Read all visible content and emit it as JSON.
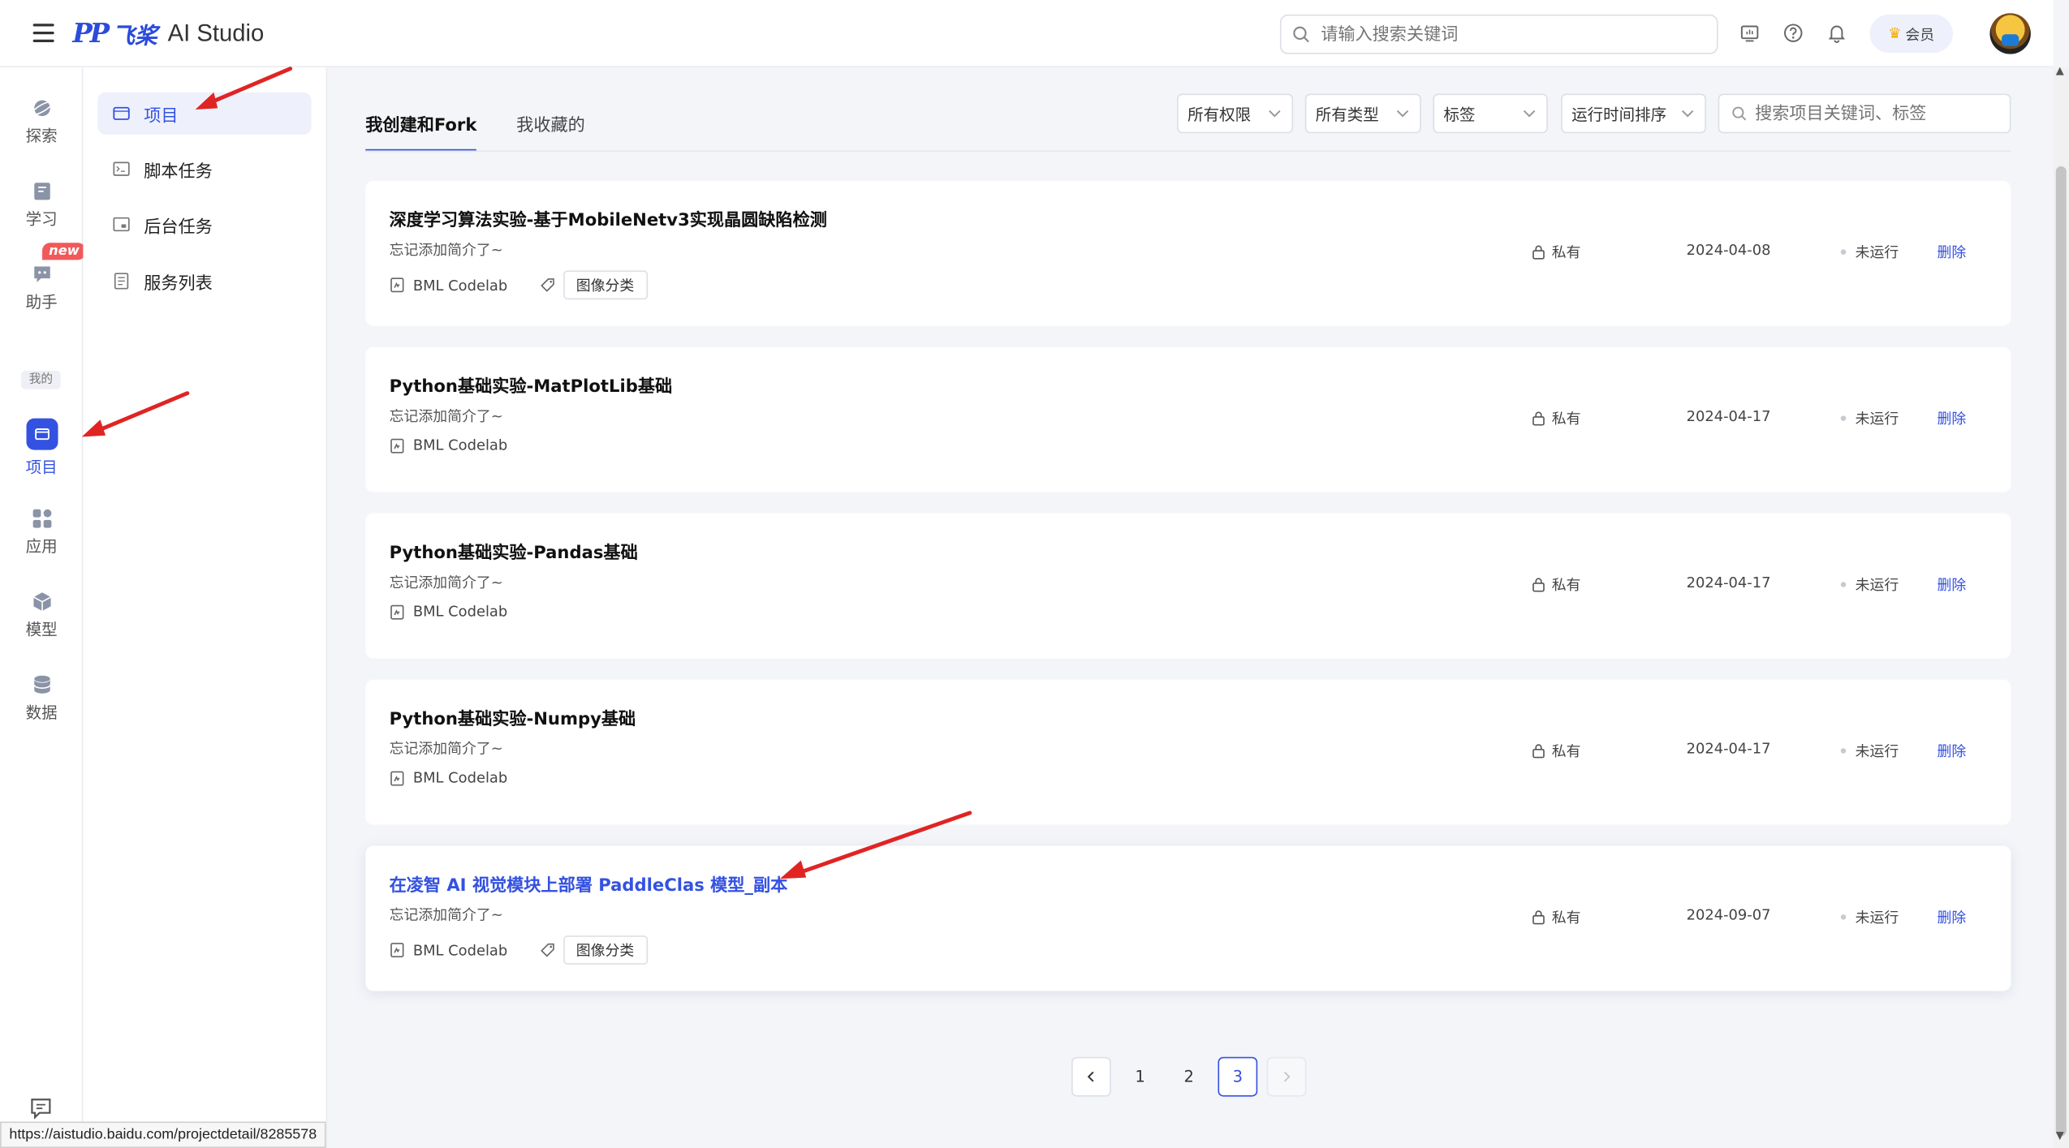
{
  "brand": {
    "mark": "PP",
    "cn": "飞桨",
    "en": "AI Studio"
  },
  "search": {
    "placeholder": "请输入搜索关键词"
  },
  "vip": {
    "label": "会员"
  },
  "rail": {
    "items": [
      {
        "label": "探索"
      },
      {
        "label": "学习"
      },
      {
        "label": "助手"
      },
      {
        "label": "项目"
      },
      {
        "label": "应用"
      },
      {
        "label": "模型"
      },
      {
        "label": "数据"
      }
    ],
    "new_badge": "new",
    "mine": "我的"
  },
  "subnav": {
    "items": [
      {
        "label": "项目"
      },
      {
        "label": "脚本任务"
      },
      {
        "label": "后台任务"
      },
      {
        "label": "服务列表"
      }
    ]
  },
  "tabs": [
    {
      "label": "我创建和Fork"
    },
    {
      "label": "我收藏的"
    }
  ],
  "filters": {
    "permission": "所有权限",
    "type": "所有类型",
    "tag": "标签",
    "sort": "运行时间排序",
    "search_placeholder": "搜索项目关键词、标签"
  },
  "projects": [
    {
      "title": "深度学习算法实验-基于MobileNetv3实现晶圆缺陷检测",
      "desc": "忘记添加简介了~",
      "env": "BML Codelab",
      "tag": "图像分类",
      "privacy": "私有",
      "date": "2024-04-08",
      "status": "未运行",
      "action": "删除"
    },
    {
      "title": "Python基础实验-MatPlotLib基础",
      "desc": "忘记添加简介了~",
      "env": "BML Codelab",
      "tag": "",
      "privacy": "私有",
      "date": "2024-04-17",
      "status": "未运行",
      "action": "删除"
    },
    {
      "title": "Python基础实验-Pandas基础",
      "desc": "忘记添加简介了~",
      "env": "BML Codelab",
      "tag": "",
      "privacy": "私有",
      "date": "2024-04-17",
      "status": "未运行",
      "action": "删除"
    },
    {
      "title": "Python基础实验-Numpy基础",
      "desc": "忘记添加简介了~",
      "env": "BML Codelab",
      "tag": "",
      "privacy": "私有",
      "date": "2024-04-17",
      "status": "未运行",
      "action": "删除"
    },
    {
      "title": "在凌智 AI 视觉模块上部署 PaddleClas 模型_副本",
      "desc": "忘记添加简介了~",
      "env": "BML Codelab",
      "tag": "图像分类",
      "privacy": "私有",
      "date": "2024-09-07",
      "status": "未运行",
      "action": "删除"
    }
  ],
  "pagination": {
    "pages": [
      "1",
      "2",
      "3"
    ],
    "current": "3"
  },
  "status_bar": {
    "url": "https://aistudio.baidu.com/projectdetail/8285578"
  },
  "colors": {
    "accent": "#3452e1",
    "annotation": "#e02424"
  }
}
